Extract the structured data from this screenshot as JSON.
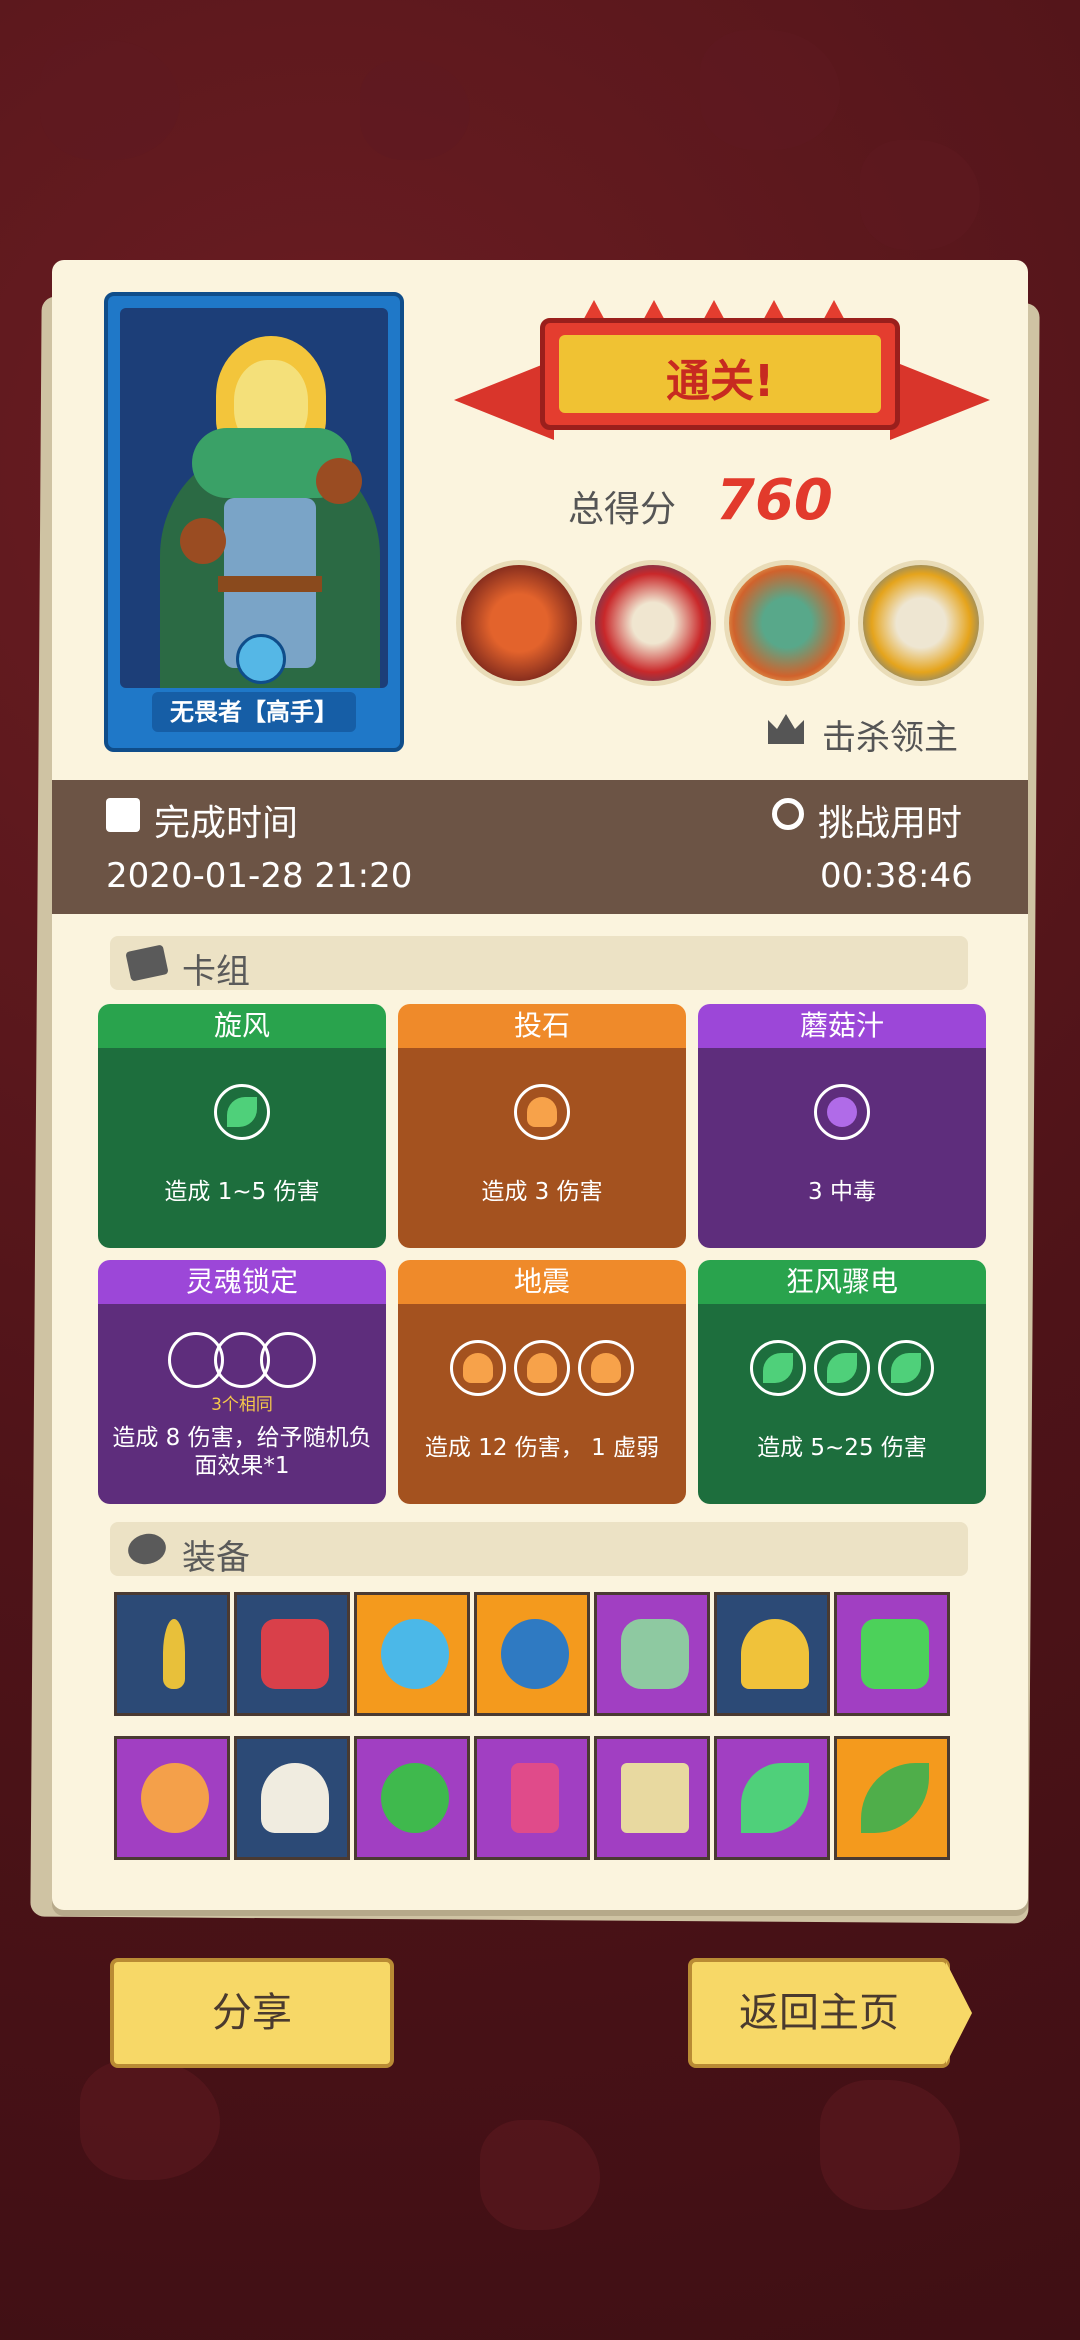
{
  "result": {
    "banner": "通关!",
    "score_label": "总得分",
    "score_value": "760",
    "boss_label": "击杀领主"
  },
  "character": {
    "name": "无畏者【高手】"
  },
  "times": {
    "finish_label": "完成时间",
    "finish_value": "2020-01-28 21:20",
    "duration_label": "挑战用时",
    "duration_value": "00:38:46"
  },
  "deck": {
    "title": "卡组",
    "cards": [
      {
        "name": "旋风",
        "desc": "造成 1~5 伤害",
        "color": "green",
        "icon": "leaf-icon"
      },
      {
        "name": "投石",
        "desc": "造成 3 伤害",
        "color": "orange",
        "icon": "rock-icon"
      },
      {
        "name": "蘑菇汁",
        "desc": "3 中毒",
        "color": "purple",
        "icon": "moon-icon"
      },
      {
        "name": "灵魂锁定",
        "note": "3个相同",
        "desc": "造成 8 伤害，给予随机负面效果*1",
        "color": "purple",
        "icon": "empty-slot-icon"
      },
      {
        "name": "地震",
        "desc": "造成 12 伤害， 1 虚弱",
        "color": "orange",
        "icon": "rock-icon"
      },
      {
        "name": "狂风骤电",
        "desc": "造成 5~25 伤害",
        "color": "green",
        "icon": "leaf-icon"
      }
    ]
  },
  "equipment": {
    "title": "装备",
    "items": [
      {
        "icon": "moon-staff-icon",
        "bg": "blue"
      },
      {
        "icon": "spiked-shield-icon",
        "bg": "blue"
      },
      {
        "icon": "crystal-skull-icon",
        "bg": "orange"
      },
      {
        "icon": "spiked-ball-icon",
        "bg": "orange"
      },
      {
        "icon": "stone-mask-icon",
        "bg": "purple"
      },
      {
        "icon": "golden-helmet-icon",
        "bg": "blue"
      },
      {
        "icon": "emerald-gem-icon",
        "bg": "purple"
      },
      {
        "icon": "orange-rock-icon",
        "bg": "purple"
      },
      {
        "icon": "skull-spear-icon",
        "bg": "blue"
      },
      {
        "icon": "potion-flask-icon",
        "bg": "purple"
      },
      {
        "icon": "totem-icon",
        "bg": "purple"
      },
      {
        "icon": "skull-book-icon",
        "bg": "purple"
      },
      {
        "icon": "green-leaf-icon",
        "bg": "purple"
      },
      {
        "icon": "feather-icon",
        "bg": "orange"
      }
    ]
  },
  "buttons": {
    "share": "分享",
    "home": "返回主页"
  },
  "colors": {
    "background": "#4e1318",
    "paper": "#fbf4de",
    "strip": "#6c5445",
    "score": "#e23a2c",
    "button": "#f7d867"
  }
}
